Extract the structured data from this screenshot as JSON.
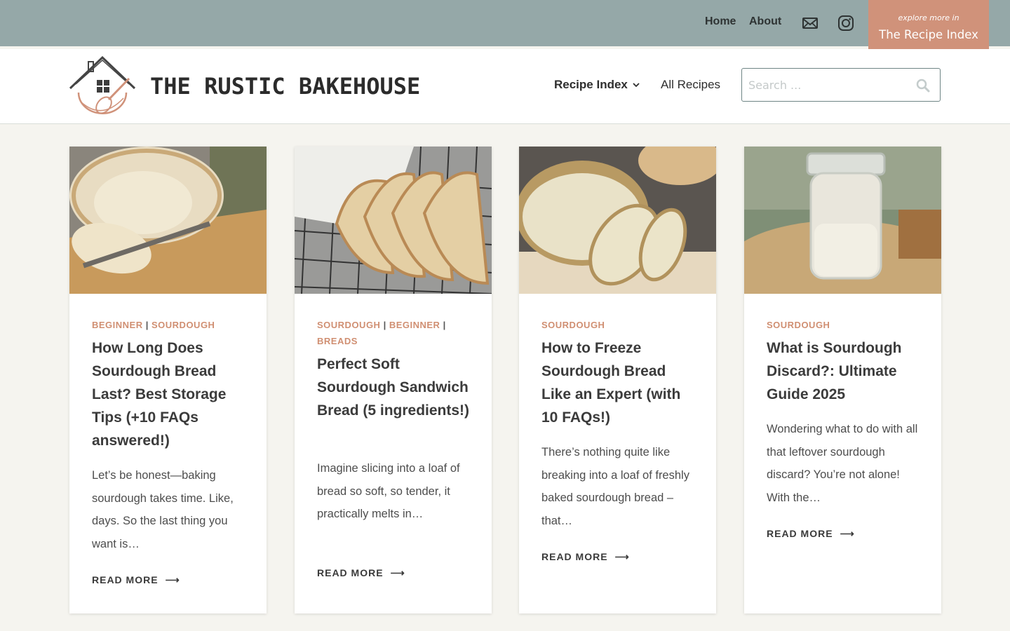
{
  "topbar": {
    "nav": [
      "Home",
      "About"
    ],
    "icons": [
      "mail-icon",
      "instagram-icon"
    ],
    "recipe_index_button": {
      "eyebrow": "explore more in",
      "title": "The Recipe Index"
    }
  },
  "header": {
    "site_title": "THE RUSTIC BAKEHOUSE",
    "nav": {
      "recipe_index": "Recipe Index",
      "all_recipes": "All Recipes"
    },
    "search": {
      "placeholder": "Search ..."
    }
  },
  "colors": {
    "topbar": "#95a8a8",
    "accent": "#d0927a",
    "category": "#d08f72",
    "page_bg": "#f5f4ef"
  },
  "posts": [
    {
      "categories": [
        "BEGINNER",
        "SOURDOUGH"
      ],
      "title": "How Long Does Sourdough Bread Last? Best Storage Tips (+10 FAQs answered!)",
      "excerpt": "Let’s be honest—baking sourdough takes time. Like, days. So the last thing you want is…",
      "read_more": "READ MORE"
    },
    {
      "categories": [
        "SOURDOUGH",
        "BEGINNER",
        "BREADS"
      ],
      "title": "Perfect Soft Sourdough Sandwich Bread (5 ingredients!)",
      "excerpt": "Imagine slicing into a loaf of bread so soft, so tender, it practically melts in…",
      "read_more": "READ MORE"
    },
    {
      "categories": [
        "SOURDOUGH"
      ],
      "title": "How to Freeze Sourdough Bread Like an Expert (with 10 FAQs!)",
      "excerpt": "There’s nothing quite like breaking into a loaf of freshly baked sourdough bread – that…",
      "read_more": "READ MORE"
    },
    {
      "categories": [
        "SOURDOUGH"
      ],
      "title": "What is Sourdough Discard?: Ultimate Guide 2025",
      "excerpt": "Wondering what to do with all that leftover sourdough discard? You’re not alone! With the…",
      "read_more": "READ MORE"
    }
  ]
}
